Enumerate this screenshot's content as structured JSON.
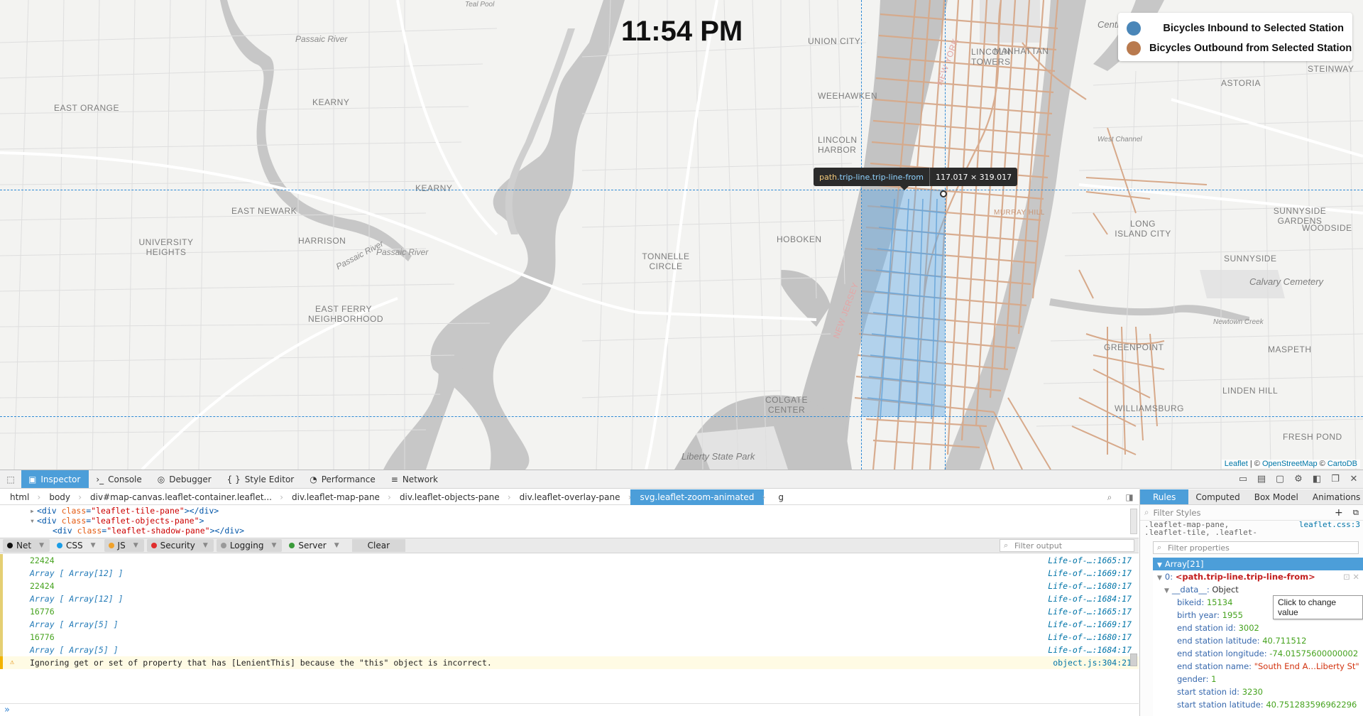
{
  "map": {
    "clock": "11:54 PM",
    "legend": [
      {
        "label": "Bicycles Inbound to Selected Station",
        "color": "#4a86b8"
      },
      {
        "label": "Bicycles Outbound from Selected Station",
        "color": "#b97a4e"
      }
    ],
    "attribution": {
      "leaflet": "Leaflet",
      "sep": " | © ",
      "osm": "OpenStreetMap",
      "mid": " © ",
      "carto": "CartoDB"
    },
    "labels": {
      "teal_pool": "Teal Pool",
      "passaic_river_1": "Passaic River",
      "east_orange": "EAST ORANGE",
      "kearny_top": "KEARNY",
      "union_city": "UNION CITY",
      "weehawken": "WEEHAWKEN",
      "lincoln_harbor": "LINCOLN HARBOR",
      "east_newark": "EAST NEWARK",
      "kearny": "KEARNY",
      "harrison": "HARRISON",
      "university_heights": "UNIVERSITY HEIGHTS",
      "hoboken": "HOBOKEN",
      "tonnelle_circle": "TONNELLE CIRCLE",
      "east_ferry": "EAST FERRY NEIGHBORHOOD",
      "passaic_river_2": "Passaic River",
      "passaic_river_3": "Passaic River",
      "colgate_center": "COLGATE CENTER",
      "liberty_state_park": "Liberty State Park",
      "central_park": "Central Park",
      "manhattan": "MANHATTAN",
      "lincoln_towers": "LINCOLN TOWERS",
      "astoria": "ASTORIA",
      "steinway": "STEINWAY",
      "sunnyside_gardens": "SUNNYSIDE GARDENS",
      "long_island_city": "LONG ISLAND CITY",
      "woodside": "WOODSIDE",
      "sunnyside": "SUNNYSIDE",
      "calvary_cemetery": "Calvary Cemetery",
      "newtown_creek": "Newtown Creek",
      "maspeth": "MASPETH",
      "greenpoint": "GREENPOINT",
      "linden_hill": "LINDEN HILL",
      "williamsburg": "WILLIAMSBURG",
      "fresh_pond": "FRESH POND",
      "west_channel": "West Channel",
      "murray_hill": "MURRAY HILL",
      "new_york": "NEW YORK",
      "new_jersey": "NEW JERSEY"
    },
    "inspector_tooltip": {
      "tag": "path",
      "class": ".trip-line.trip-line-from",
      "size": "117.017 × 319.017"
    }
  },
  "devtools": {
    "tabs": [
      {
        "label": "Inspector",
        "icon": "inspector-icon",
        "active": true
      },
      {
        "label": "Console",
        "icon": "console-icon"
      },
      {
        "label": "Debugger",
        "icon": "debugger-icon"
      },
      {
        "label": "Style Editor",
        "icon": "style-editor-icon"
      },
      {
        "label": "Performance",
        "icon": "performance-icon"
      },
      {
        "label": "Network",
        "icon": "network-icon"
      }
    ],
    "breadcrumbs": [
      "html",
      "body",
      "div#map-canvas.leaflet-container.leaflet...",
      "div.leaflet-map-pane",
      "div.leaflet-objects-pane",
      "div.leaflet-overlay-pane",
      "svg.leaflet-zoom-animated",
      "g"
    ],
    "markup": {
      "line1": {
        "tag_open": "<div ",
        "attr": "class",
        "eq": "=",
        "val": "\"leaflet-tile-pane\"",
        "tag_close": "></div>"
      },
      "line2": {
        "tag_open": "<div ",
        "attr": "class",
        "eq": "=",
        "val": "\"leaflet-objects-pane\"",
        "tag_close": ">"
      },
      "line3": {
        "tag_open": "<div ",
        "attr": "class",
        "eq": "=",
        "val": "\"leaflet-shadow-pane\"",
        "tag_close": "></div>"
      }
    },
    "filters": [
      {
        "label": "Net",
        "color": "#111",
        "on": true
      },
      {
        "label": "CSS",
        "color": "#1b9de6",
        "on": false
      },
      {
        "label": "JS",
        "color": "#f0a22b",
        "on": true
      },
      {
        "label": "Security",
        "color": "#e02d2d",
        "on": true
      },
      {
        "label": "Logging",
        "color": "#999999",
        "on": true
      },
      {
        "label": "Server",
        "color": "#3a9b3a",
        "on": false
      }
    ],
    "clear_label": "Clear",
    "filter_output_placeholder": "Filter output",
    "console_rows": [
      {
        "text": "22424",
        "kind": "num",
        "src": "Life-of-…:1665:17"
      },
      {
        "text": "Array [ Array[12] ]",
        "kind": "obj",
        "src": "Life-of-…:1669:17"
      },
      {
        "text": "22424",
        "kind": "num",
        "src": "Life-of-…:1680:17"
      },
      {
        "text": "Array [ Array[12] ]",
        "kind": "obj",
        "src": "Life-of-…:1684:17"
      },
      {
        "text": "16776",
        "kind": "num",
        "src": "Life-of-…:1665:17"
      },
      {
        "text": "Array [ Array[5] ]",
        "kind": "obj",
        "src": "Life-of-…:1669:17"
      },
      {
        "text": "16776",
        "kind": "num",
        "src": "Life-of-…:1680:17"
      },
      {
        "text": "Array [ Array[5] ]",
        "kind": "obj",
        "src": "Life-of-…:1684:17"
      }
    ],
    "warning": {
      "text": "Ignoring get or set of property that has [LenientThis] because the \"this\" object is incorrect.",
      "src": "object.js:304:21"
    },
    "side_tabs": [
      "Rules",
      "Computed",
      "Box Model",
      "Animations"
    ],
    "filter_styles_placeholder": "Filter Styles",
    "css_rule": {
      "selector_1": ".leaflet-map-pane,",
      "selector_2": ".leaflet-tile, .leaflet-",
      "file": "leaflet.css:3"
    },
    "filter_properties_placeholder": "Filter properties",
    "variables": {
      "head": "Array[21]",
      "item0_key": "0:",
      "item0_val": "<path.trip-line.trip-line-from>",
      "data_key": "__data__:",
      "data_val": "Object",
      "fields": [
        {
          "k": "bikeid:",
          "v": "15134",
          "t": "n"
        },
        {
          "k": "birth year:",
          "v": "1955",
          "t": "n"
        },
        {
          "k": "end station id:",
          "v": "3002",
          "t": "n"
        },
        {
          "k": "end station latitude:",
          "v": "40.711512",
          "t": "n"
        },
        {
          "k": "end station longitude:",
          "v": "-74.01575600000002",
          "t": "n"
        },
        {
          "k": "end station name:",
          "v": "\"South End A…Liberty St\"",
          "t": "s"
        },
        {
          "k": "gender:",
          "v": "1",
          "t": "n"
        },
        {
          "k": "start station id:",
          "v": "3230",
          "t": "n"
        },
        {
          "k": "start station latitude:",
          "v": "40.751283596962296",
          "t": "n"
        }
      ]
    },
    "change_value_tooltip": "Click to change value"
  }
}
